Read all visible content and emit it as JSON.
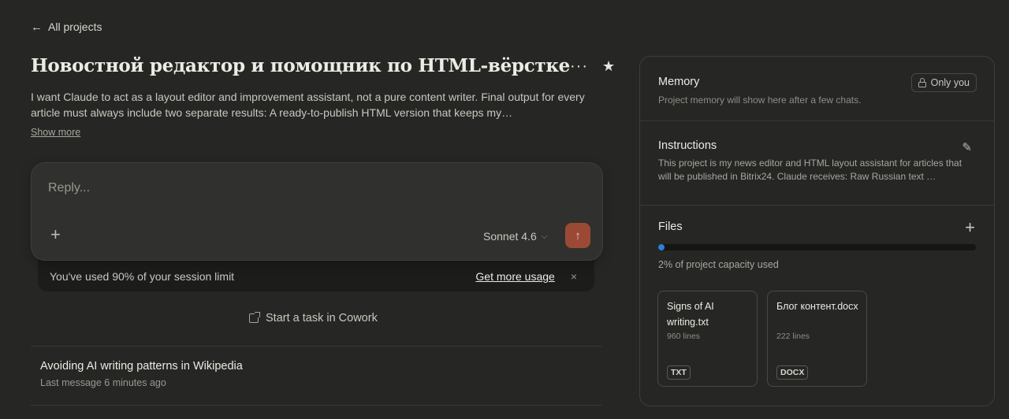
{
  "nav": {
    "back_label": "All projects",
    "back_icon": "arrow-left-icon"
  },
  "project": {
    "title": "Новостной редактор и помощник по HTML-вёрстке",
    "description": "I want Claude to act as a layout editor and improvement assistant, not a pure content writer. Final output for every article must always include two separate results: A ready-to-publish HTML version that keeps my…",
    "show_more_label": "Show more",
    "more_icon": "more-horizontal-icon",
    "star_icon": "star-icon"
  },
  "composer": {
    "placeholder": "Reply...",
    "add_icon": "plus-icon",
    "model_label": "Sonnet 4.6",
    "send_icon": "arrow-up-icon",
    "send_color": "#9a4a34"
  },
  "limit_banner": {
    "text": "You've used 90% of your session limit",
    "cta_label": "Get more usage",
    "close_label": "×"
  },
  "cowork": {
    "label": "Start a task in Cowork",
    "icon": "external-link-icon"
  },
  "chats": [
    {
      "title": "Avoiding AI writing patterns in Wikipedia",
      "meta": "Last message 6 minutes ago"
    }
  ],
  "panel": {
    "memory": {
      "title": "Memory",
      "subtitle": "Project memory will show here after a few chats.",
      "visibility_label": "Only you",
      "visibility_icon": "lock-icon"
    },
    "instructions": {
      "title": "Instructions",
      "text": "This project is my news editor and HTML layout assistant for articles that will be published in Bitrix24. Claude receives: Raw Russian text …",
      "edit_icon": "pencil-icon"
    },
    "files": {
      "title": "Files",
      "add_icon": "plus-icon",
      "capacity_fraction": 0.02,
      "capacity_color": "#2f7fe0",
      "capacity_text": "2% of project capacity used",
      "items": [
        {
          "name": "Signs of AI writing.txt",
          "lines": "960 lines",
          "type": "TXT"
        },
        {
          "name": "Блог контент.docx",
          "lines": "222 lines",
          "type": "DOCX"
        }
      ]
    }
  }
}
